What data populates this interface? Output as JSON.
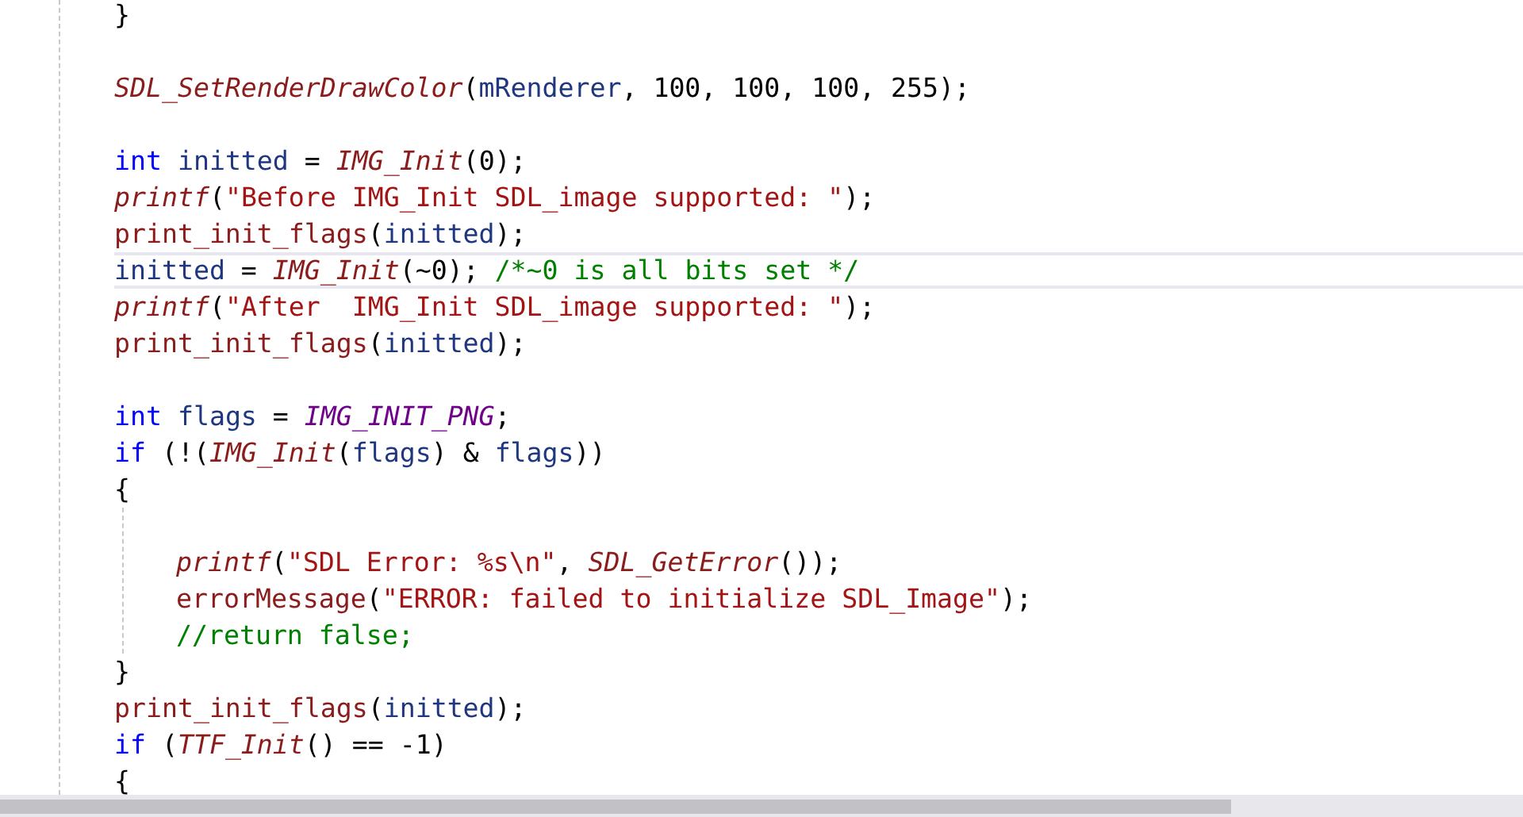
{
  "editor": {
    "lines": [
      {
        "kind": "code",
        "current": false,
        "tokens": [
          {
            "text": "}",
            "kind": "plain"
          }
        ]
      },
      {
        "kind": "blank",
        "current": false
      },
      {
        "kind": "code",
        "current": false,
        "tokens": [
          {
            "text": "SDL_SetRenderDrawColor",
            "kind": "call"
          },
          {
            "text": "(",
            "kind": "plain"
          },
          {
            "text": "mRenderer",
            "kind": "var"
          },
          {
            "text": ", 100, 100, 100, 255);",
            "kind": "plain"
          }
        ]
      },
      {
        "kind": "blank",
        "current": false
      },
      {
        "kind": "code",
        "current": false,
        "tokens": [
          {
            "text": "int ",
            "kind": "keyword"
          },
          {
            "text": "initted",
            "kind": "var"
          },
          {
            "text": " = ",
            "kind": "plain"
          },
          {
            "text": "IMG_Init",
            "kind": "call"
          },
          {
            "text": "(0);",
            "kind": "plain"
          }
        ]
      },
      {
        "kind": "code",
        "current": false,
        "tokens": [
          {
            "text": "printf",
            "kind": "call"
          },
          {
            "text": "(",
            "kind": "plain"
          },
          {
            "text": "\"Before IMG_Init SDL_image supported: \"",
            "kind": "string"
          },
          {
            "text": ");",
            "kind": "plain"
          }
        ]
      },
      {
        "kind": "code",
        "current": false,
        "tokens": [
          {
            "text": "print_init_flags",
            "kind": "function"
          },
          {
            "text": "(",
            "kind": "plain"
          },
          {
            "text": "initted",
            "kind": "var"
          },
          {
            "text": ");",
            "kind": "plain"
          }
        ]
      },
      {
        "kind": "code",
        "current": true,
        "tokens": [
          {
            "text": "initted",
            "kind": "var"
          },
          {
            "text": " = ",
            "kind": "plain"
          },
          {
            "text": "IMG_Init",
            "kind": "call"
          },
          {
            "text": "(~0); ",
            "kind": "plain"
          },
          {
            "text": "/*~0 is all bits set */",
            "kind": "comment"
          }
        ]
      },
      {
        "kind": "code",
        "current": false,
        "tokens": [
          {
            "text": "printf",
            "kind": "call"
          },
          {
            "text": "(",
            "kind": "plain"
          },
          {
            "text": "\"After  IMG_Init SDL_image supported: \"",
            "kind": "string"
          },
          {
            "text": ");",
            "kind": "plain"
          }
        ]
      },
      {
        "kind": "code",
        "current": false,
        "tokens": [
          {
            "text": "print_init_flags",
            "kind": "function"
          },
          {
            "text": "(",
            "kind": "plain"
          },
          {
            "text": "initted",
            "kind": "var"
          },
          {
            "text": ");",
            "kind": "plain"
          }
        ]
      },
      {
        "kind": "blank",
        "current": false
      },
      {
        "kind": "code",
        "current": false,
        "tokens": [
          {
            "text": "int ",
            "kind": "keyword"
          },
          {
            "text": "flags",
            "kind": "var"
          },
          {
            "text": " = ",
            "kind": "plain"
          },
          {
            "text": "IMG_INIT_PNG",
            "kind": "macro"
          },
          {
            "text": ";",
            "kind": "plain"
          }
        ]
      },
      {
        "kind": "code",
        "current": false,
        "tokens": [
          {
            "text": "if",
            "kind": "keyword"
          },
          {
            "text": " (!(",
            "kind": "plain"
          },
          {
            "text": "IMG_Init",
            "kind": "call"
          },
          {
            "text": "(",
            "kind": "plain"
          },
          {
            "text": "flags",
            "kind": "var"
          },
          {
            "text": ") & ",
            "kind": "plain"
          },
          {
            "text": "flags",
            "kind": "var"
          },
          {
            "text": "))",
            "kind": "plain"
          }
        ]
      },
      {
        "kind": "code",
        "current": false,
        "tokens": [
          {
            "text": "{",
            "kind": "plain"
          }
        ],
        "children": [
          {
            "kind": "blank",
            "current": false
          },
          {
            "kind": "code",
            "current": false,
            "tokens": [
              {
                "text": "printf",
                "kind": "call"
              },
              {
                "text": "(",
                "kind": "plain"
              },
              {
                "text": "\"SDL Error: %s\\n\"",
                "kind": "string"
              },
              {
                "text": ", ",
                "kind": "plain"
              },
              {
                "text": "SDL_GetError",
                "kind": "call"
              },
              {
                "text": "());",
                "kind": "plain"
              }
            ]
          },
          {
            "kind": "code",
            "current": false,
            "tokens": [
              {
                "text": "errorMessage",
                "kind": "function"
              },
              {
                "text": "(",
                "kind": "plain"
              },
              {
                "text": "\"ERROR: failed to initialize SDL_Image\"",
                "kind": "string"
              },
              {
                "text": ");",
                "kind": "plain"
              }
            ]
          },
          {
            "kind": "code",
            "current": false,
            "tokens": [
              {
                "text": "//return false;",
                "kind": "comment"
              }
            ]
          }
        ]
      },
      {
        "kind": "code",
        "current": false,
        "tokens": [
          {
            "text": "}",
            "kind": "plain"
          }
        ]
      },
      {
        "kind": "code",
        "current": false,
        "tokens": [
          {
            "text": "print_init_flags",
            "kind": "function"
          },
          {
            "text": "(",
            "kind": "plain"
          },
          {
            "text": "initted",
            "kind": "var"
          },
          {
            "text": ");",
            "kind": "plain"
          }
        ]
      },
      {
        "kind": "code",
        "current": false,
        "tokens": [
          {
            "text": "if",
            "kind": "keyword"
          },
          {
            "text": " (",
            "kind": "plain"
          },
          {
            "text": "TTF_Init",
            "kind": "call"
          },
          {
            "text": "() == -1)",
            "kind": "plain"
          }
        ]
      },
      {
        "kind": "code",
        "current": false,
        "tokens": [
          {
            "text": "{",
            "kind": "plain"
          }
        ]
      }
    ]
  }
}
